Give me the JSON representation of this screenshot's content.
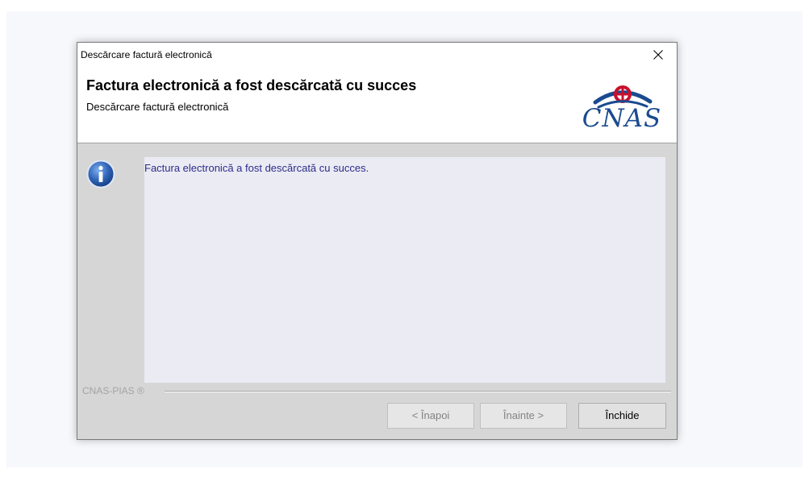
{
  "window": {
    "title": "Descărcare factură electronică",
    "close_icon": "close-icon"
  },
  "header": {
    "title": "Factura electronică a fost descărcată cu succes",
    "subtitle": "Descărcare factură electronică",
    "logo_text": "CNAS"
  },
  "message": {
    "icon": "info-icon",
    "text": "Factura electronică a fost descărcată cu succes."
  },
  "footer": {
    "brand": "CNAS-PIAS ®"
  },
  "buttons": {
    "back": "< Înapoi",
    "next": "Înainte >",
    "close": "Închide"
  },
  "colors": {
    "accent_red": "#c8102e",
    "brand_blue": "#1b4a8f",
    "message_text": "#2c2c8a"
  }
}
